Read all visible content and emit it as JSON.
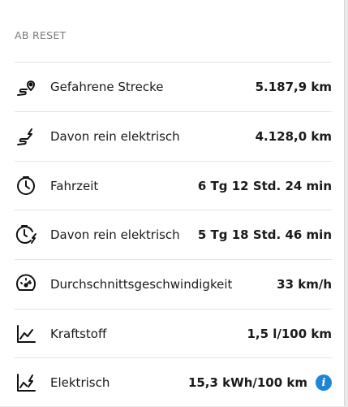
{
  "section_header": "AB RESET",
  "rows": [
    {
      "icon": "route-pin-icon",
      "label": "Gefahrene Strecke",
      "value": "5.187,9 km"
    },
    {
      "icon": "electric-route-icon",
      "label": "Davon rein elektrisch",
      "value": "4.128,0 km"
    },
    {
      "icon": "clock-icon",
      "label": "Fahrzeit",
      "value": "6 Tg 12 Std. 24 min"
    },
    {
      "icon": "electric-clock-icon",
      "label": "Davon rein elektrisch",
      "value": "5 Tg 18 Std. 46 min"
    },
    {
      "icon": "speedometer-icon",
      "label": "Durchschnittsgeschwindigkeit",
      "value": "33 km/h"
    },
    {
      "icon": "fuel-chart-icon",
      "label": "Kraftstoff",
      "value": "1,5 l/100 km"
    },
    {
      "icon": "electric-chart-icon",
      "label": "Elektrisch",
      "value": "15,3 kWh/100 km"
    }
  ],
  "info_glyph": "i",
  "colors": {
    "accent_info": "#1f86d6",
    "divider": "#e3e3e3",
    "header_text": "#7a7a7a"
  }
}
